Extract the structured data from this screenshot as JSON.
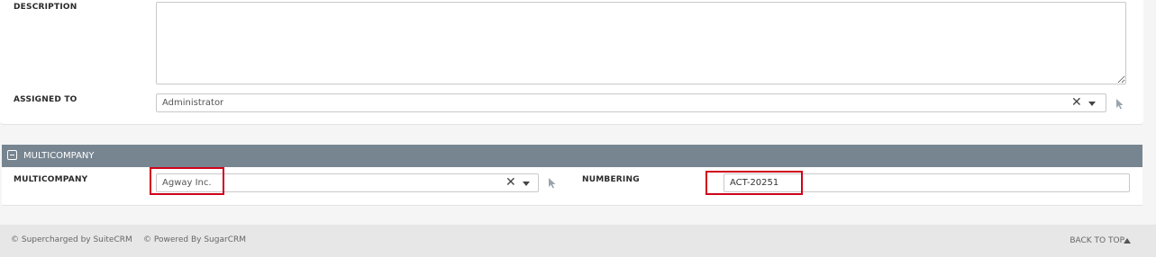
{
  "fields": {
    "description_label": "DESCRIPTION",
    "description_value": "",
    "assigned_label": "ASSIGNED TO",
    "assigned_value": "Administrator"
  },
  "section": {
    "title": "MULTICOMPANY",
    "multicompany_label": "MULTICOMPANY",
    "multicompany_value": "Agway Inc.",
    "numbering_label": "NUMBERING",
    "numbering_value": "ACT-20251"
  },
  "footer": {
    "supercharged": "© Supercharged by SuiteCRM",
    "powered": "© Powered By SugarCRM",
    "back_to_top": "BACK TO TOP"
  },
  "colors": {
    "section_header_bg": "#778591",
    "highlight": "#d0021b"
  },
  "icons": [
    "clear-icon",
    "caret-down-icon",
    "select-pointer-icon",
    "collapse-icon",
    "back-to-top-icon"
  ]
}
